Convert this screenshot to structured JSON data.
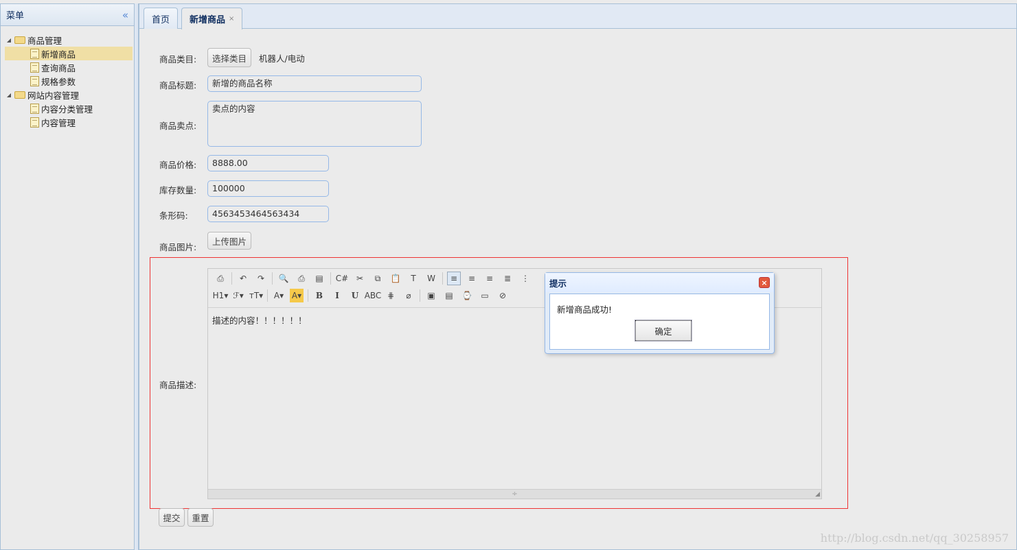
{
  "sidebar": {
    "title": "菜单",
    "collapse_icon": "«",
    "tree": [
      {
        "label": "商品管理",
        "children": [
          "新增商品",
          "查询商品",
          "规格参数"
        ]
      },
      {
        "label": "网站内容管理",
        "children": [
          "内容分类管理",
          "内容管理"
        ]
      }
    ],
    "selected": "新增商品"
  },
  "tabs": [
    {
      "label": "首页"
    },
    {
      "label": "新增商品",
      "close": "×"
    }
  ],
  "form": {
    "category": {
      "label": "商品类目:",
      "button": "选择类目",
      "value": "机器人/电动"
    },
    "title": {
      "label": "商品标题:",
      "value": "新增的商品名称"
    },
    "sell_point": {
      "label": "商品卖点:",
      "value": "卖点的内容"
    },
    "price": {
      "label": "商品价格:",
      "value": "8888.00"
    },
    "stock": {
      "label": "库存数量:",
      "value": "100000"
    },
    "barcode": {
      "label": "条形码:",
      "value": "4563453464563434"
    },
    "image": {
      "label": "商品图片:",
      "button": "上传图片"
    },
    "desc": {
      "label": "商品描述:",
      "value": "描述的内容！！！！！！"
    },
    "submit": "提交",
    "reset": "重置"
  },
  "editor": {
    "row1_icons": [
      "source-icon",
      "undo-icon",
      "redo-icon",
      "preview-icon",
      "print-icon",
      "template-icon",
      "code-icon",
      "cut-icon",
      "copy-icon",
      "paste-icon",
      "paste-text-icon",
      "paste-word-icon",
      "align-left-icon",
      "align-center-icon",
      "align-right-icon",
      "justify-icon",
      "ordered-list-icon"
    ],
    "row1_glyphs": [
      "⎙",
      "↶",
      "↷",
      "🔍",
      "⎙",
      "▤",
      "C#",
      "✂",
      "⧉",
      "📋",
      "T",
      "W",
      "≡",
      "≡",
      "≡",
      "≣",
      "⋮"
    ],
    "row2_items": [
      "H1▾",
      "ℱ▾",
      "тT▾",
      "A▾",
      "A▾",
      "B",
      "I",
      "U",
      "ABC",
      "⋕",
      "⌀",
      "▣",
      "▤",
      "⌚",
      "▭",
      "⊘"
    ],
    "resize_glyph": "÷",
    "grip": "◢"
  },
  "dialog": {
    "title": "提示",
    "close": "×",
    "message": "新增商品成功!",
    "ok": "确定"
  },
  "watermark": "http://blog.csdn.net/qq_30258957",
  "colors": {
    "accent": "#95b8e7",
    "selected_bg": "#f0dfa5",
    "highlight_border": "#ee3333"
  }
}
